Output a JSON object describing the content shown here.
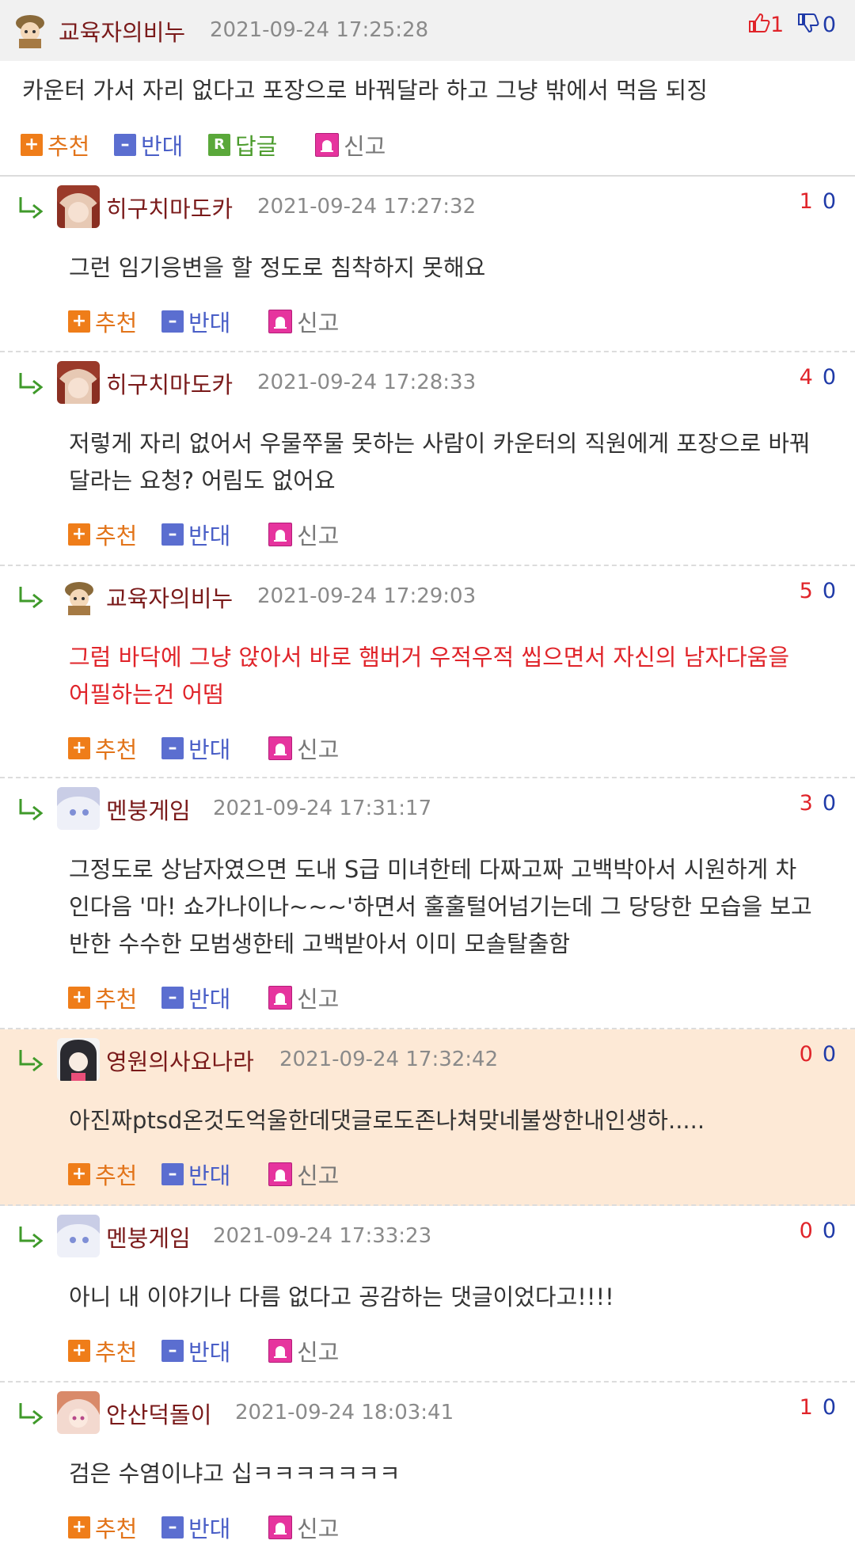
{
  "labels": {
    "recommend": "추천",
    "oppose": "반대",
    "reply": "답글",
    "report": "신고"
  },
  "root": {
    "author": "교육자의비누",
    "date": "2021-09-24 17:25:28",
    "up": "1",
    "down": "0",
    "text": "카운터 가서 자리 없다고 포장으로 바꿔달라 하고 그냥 밖에서 먹음 되징"
  },
  "replies": [
    {
      "author": "히구치마도카",
      "date": "2021-09-24 17:27:32",
      "up": "1",
      "down": "0",
      "text": "그런 임기응변을 할 정도로 침착하지 못해요"
    },
    {
      "author": "히구치마도카",
      "date": "2021-09-24 17:28:33",
      "up": "4",
      "down": "0",
      "text1": "저렇게 자리 없어서 우물쭈물 못하는 사람이 카운터의 직원에게 포장으로 바꿔",
      "text2": "달라는 요청? 어림도 없어요"
    },
    {
      "author": "교육자의비누",
      "date": "2021-09-24 17:29:03",
      "up": "5",
      "down": "0",
      "text1": "그럼 바닥에 그냥 앉아서 바로 햄버거 우적우적 씹으면서 자신의 남자다움을",
      "text2": "어필하는건 어떰"
    },
    {
      "author": "멘붕게임",
      "date": "2021-09-24 17:31:17",
      "up": "3",
      "down": "0",
      "text1": "그정도로 상남자였으면 도내 S급 미녀한테 다짜고짜 고백박아서 시원하게 차",
      "text2": "인다음 '마! 쇼가나이나~~~'하면서 훌훌털어넘기는데 그 당당한 모습을 보고",
      "text3": "반한 수수한 모범생한테 고백받아서 이미 모솔탈출함"
    },
    {
      "author": "영원의사요나라",
      "date": "2021-09-24 17:32:42",
      "up": "0",
      "down": "0",
      "text": "아진짜ptsd온것도억울한데댓글로도존나쳐맞네불쌍한내인생하....."
    },
    {
      "author": "멘붕게임",
      "date": "2021-09-24 17:33:23",
      "up": "0",
      "down": "0",
      "text": "아니 내 이야기나 다름 없다고 공감하는 댓글이었다고!!!!"
    },
    {
      "author": "안산덕돌이",
      "date": "2021-09-24 18:03:41",
      "up": "1",
      "down": "0",
      "text": "검은 수염이냐고 십ㅋㅋㅋㅋㅋㅋㅋ"
    }
  ]
}
